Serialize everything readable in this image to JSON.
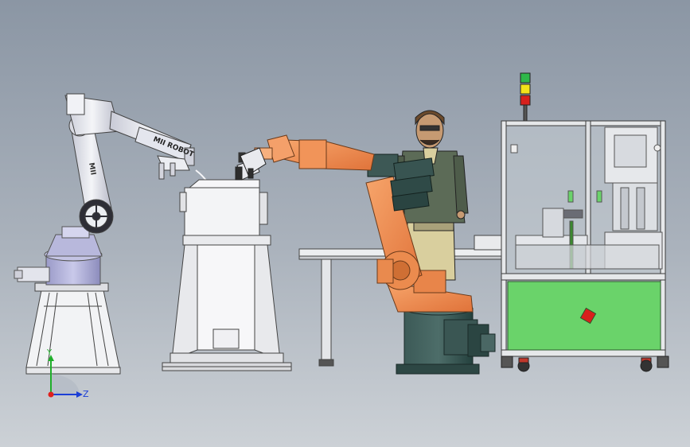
{
  "robot_left": {
    "arm_text": "MII ROBOT",
    "arm_text_short": "MII"
  },
  "triad": {
    "y_label": "Y",
    "z_label": "Z"
  },
  "signal_tower": {
    "colors": [
      "#2fb84a",
      "#f2e21a",
      "#d8201c"
    ]
  },
  "palette": {
    "background_top": "#8d98a6",
    "background_bottom": "#c9ced4",
    "orange_robot": "#f08a4a",
    "dark_teal": "#2f4a48",
    "machine_green": "#6ad36a",
    "steel_light": "#f1f2f4"
  }
}
